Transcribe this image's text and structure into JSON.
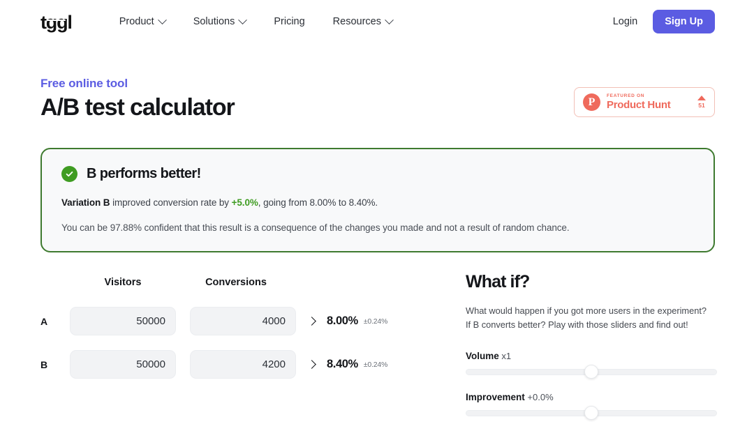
{
  "nav": {
    "logo": "tggl",
    "items": [
      {
        "label": "Product",
        "has_caret": true
      },
      {
        "label": "Solutions",
        "has_caret": true
      },
      {
        "label": "Pricing",
        "has_caret": false
      },
      {
        "label": "Resources",
        "has_caret": true
      }
    ],
    "login_label": "Login",
    "signup_label": "Sign Up",
    "accent_color": "#5b5ce2"
  },
  "hero": {
    "eyebrow": "Free online tool",
    "title": "A/B test calculator"
  },
  "product_hunt": {
    "featured_label": "FEATURED ON",
    "name": "Product Hunt",
    "upvotes": "51",
    "color": "#ef6a5c",
    "mark": "P"
  },
  "banner": {
    "title": "B performs better!",
    "border_color": "#3e7a2f",
    "accent_color": "#3f9c22",
    "line1": {
      "lead": "Variation B",
      "mid": " improved conversion rate by ",
      "delta": "+5.0%",
      "tail": ", going from 8.00% to 8.40%."
    },
    "line2": "You can be 97.88% confident that this result is a consequence of the changes you made and not a result of random chance."
  },
  "calculator": {
    "headers": {
      "visitors": "Visitors",
      "conversions": "Conversions"
    },
    "rows": [
      {
        "letter": "A",
        "visitors": "50000",
        "conversions": "4000",
        "rate": "8.00%",
        "margin": "±0.24%"
      },
      {
        "letter": "B",
        "visitors": "50000",
        "conversions": "4200",
        "rate": "8.40%",
        "margin": "±0.24%"
      }
    ]
  },
  "whatif": {
    "title": "What if?",
    "description": "What would happen if you got more users in the experiment? If B converts better? Play with those sliders and find out!",
    "sliders": [
      {
        "name": "Volume",
        "value": "x1",
        "position_pct": 50
      },
      {
        "name": "Improvement",
        "value": "+0.0%",
        "position_pct": 50
      }
    ]
  }
}
